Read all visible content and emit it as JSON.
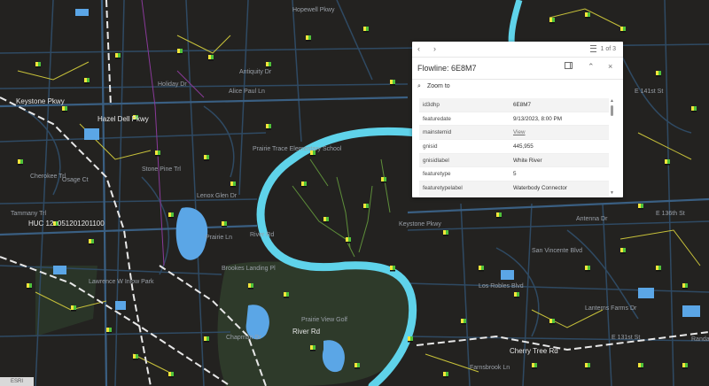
{
  "map": {
    "street_labels": [
      {
        "text": "Hopewell Pkwy"
      },
      {
        "text": "Antiquity Dr"
      },
      {
        "text": "Alice Paul Ln"
      },
      {
        "text": "Holiday Dr"
      },
      {
        "text": "Stone Pine Trl"
      },
      {
        "text": "Osage Ct"
      },
      {
        "text": "Tammany Trl"
      },
      {
        "text": "Cherokee Trl"
      },
      {
        "text": "Lenox Glen Dr"
      },
      {
        "text": "Prairie Trace Elementary School"
      },
      {
        "text": "River Rd"
      },
      {
        "text": "Prairie View Golf"
      },
      {
        "text": "Brookes Landing Pl"
      },
      {
        "text": "Chapman Dr"
      },
      {
        "text": "E 141st St"
      },
      {
        "text": "E 131st St"
      },
      {
        "text": "Antenna Dr"
      },
      {
        "text": "Lanterns Farms Dr"
      },
      {
        "text": "Los Robles Blvd"
      },
      {
        "text": "San Vincente Blvd"
      },
      {
        "text": "Lawrence W Inlow Park"
      },
      {
        "text": "Keystone Pkwy"
      },
      {
        "text": "E 136th St"
      },
      {
        "text": "Farnsbrook Ln"
      },
      {
        "text": "Randall Dr"
      },
      {
        "text": "Prairie Ln"
      }
    ],
    "highway_labels": [
      {
        "text": "Keystone Pkwy"
      },
      {
        "text": "Hazel Dell Pkwy"
      },
      {
        "text": "River Rd"
      },
      {
        "text": "Cherry Tree Rd"
      }
    ],
    "badge_label": "HUC 12: 051201201100",
    "corner_text": "ESRI"
  },
  "popup": {
    "page_indicator": "1 of 3",
    "title": "Flowline: 6E8M7",
    "zoom_to_label": "Zoom to",
    "attributes": [
      {
        "key": "id3dhp",
        "value": "6E8M7"
      },
      {
        "key": "featuredate",
        "value": "9/13/2023, 8:00 PM"
      },
      {
        "key": "mainstemid",
        "value": "View"
      },
      {
        "key": "gnisid",
        "value": "445,955"
      },
      {
        "key": "gnisidlabel",
        "value": "White River"
      },
      {
        "key": "featuretype",
        "value": "5"
      },
      {
        "key": "featuretypelabel",
        "value": "Waterbody Connector"
      }
    ]
  }
}
